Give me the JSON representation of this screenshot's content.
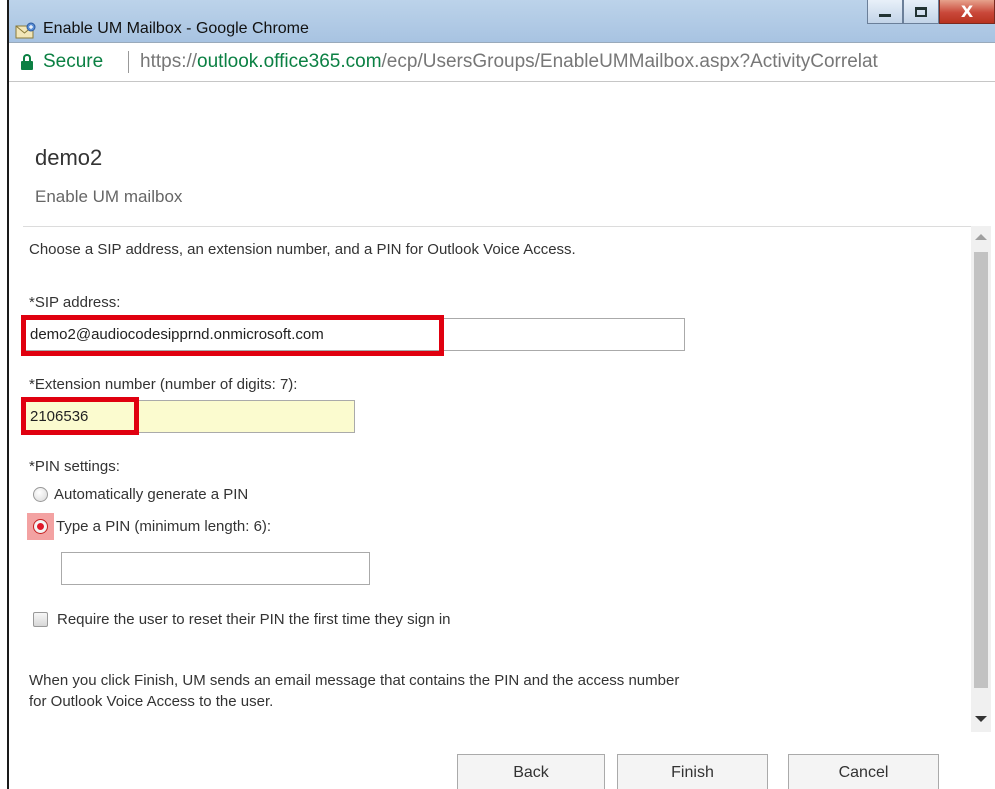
{
  "window": {
    "title": "Enable UM Mailbox - Google Chrome",
    "close_glyph": "X"
  },
  "address_bar": {
    "secure_label": "Secure",
    "url_scheme": "https://",
    "url_host": "outlook.office365.com",
    "url_path": "/ecp/UsersGroups/EnableUMMailbox.aspx?ActivityCorrelat"
  },
  "page": {
    "title": "demo2",
    "subtitle": "Enable UM mailbox",
    "intro": "Choose a SIP address, an extension number, and a PIN for Outlook Voice Access."
  },
  "form": {
    "sip_label": "*SIP address:",
    "sip_value": "demo2@audiocodesipprnd.onmicrosoft.com",
    "extension_label": "*Extension number (number of digits: 7):",
    "extension_value": "2106536",
    "pin_settings_label": "*PIN settings:",
    "pin_options": [
      {
        "label": "Automatically generate a PIN",
        "selected": false
      },
      {
        "label": "Type a PIN (minimum length: 6):",
        "selected": true
      }
    ],
    "pin_value": "",
    "reset_pin_label": "Require the user to reset their PIN the first time they sign in",
    "reset_pin_checked": false,
    "note": "When you click Finish, UM sends an email message that contains the PIN and the access number for Outlook Voice Access to the user."
  },
  "buttons": {
    "back": "Back",
    "finish": "Finish",
    "cancel": "Cancel"
  },
  "colors": {
    "highlight": "#e0000f",
    "secure_green": "#0b8043",
    "extension_field_bg": "#fbfbcf"
  }
}
